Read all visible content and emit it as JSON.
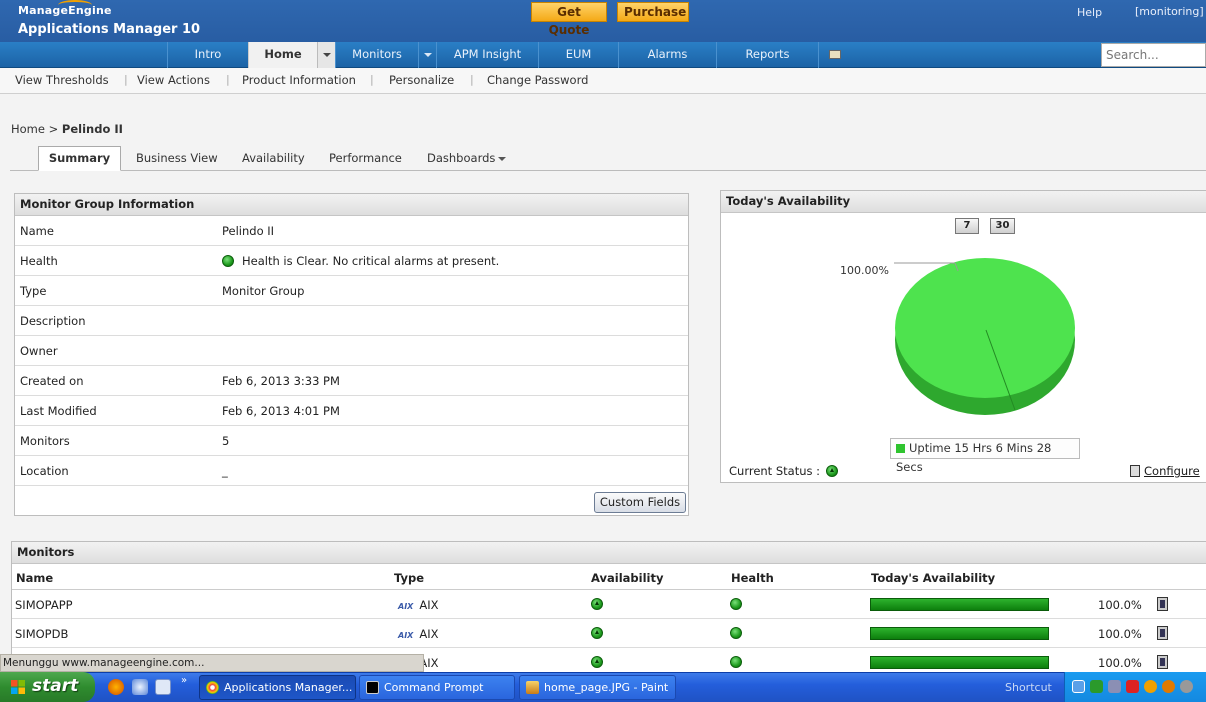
{
  "header": {
    "brand_top": "ManageEngine",
    "brand_bottom": "Applications Manager 10",
    "get_quote": "Get Quote",
    "purchase": "Purchase",
    "help": "Help",
    "user": "[monitoring]"
  },
  "nav": {
    "items": [
      "Intro",
      "Home",
      "Monitors",
      "APM Insight",
      "EUM",
      "Alarms",
      "Reports"
    ],
    "active": "Home",
    "search_placeholder": "Search..."
  },
  "subnav": [
    "View Thresholds",
    "View Actions",
    "Product Information",
    "Personalize",
    "Change Password"
  ],
  "breadcrumb": {
    "root": "Home >",
    "current": "Pelindo II"
  },
  "tabs": [
    "Summary",
    "Business View",
    "Availability",
    "Performance",
    "Dashboards"
  ],
  "group_info": {
    "title": "Monitor Group Information",
    "rows": [
      {
        "k": "Name",
        "v": "Pelindo II"
      },
      {
        "k": "Health",
        "v": "Health is Clear. No critical alarms at present."
      },
      {
        "k": "Type",
        "v": "Monitor Group"
      },
      {
        "k": "Description",
        "v": ""
      },
      {
        "k": "Owner",
        "v": ""
      },
      {
        "k": "Created on",
        "v": "Feb 6, 2013 3:33 PM"
      },
      {
        "k": "Last Modified",
        "v": "Feb 6, 2013 4:01 PM"
      },
      {
        "k": "Monitors",
        "v": "5"
      },
      {
        "k": "Location",
        "v": "_"
      }
    ],
    "custom_fields": "Custom Fields"
  },
  "availability": {
    "title": "Today's Availability",
    "period_7": "7",
    "period_30": "30",
    "pie_label": "100.00%",
    "legend": "Uptime 15 Hrs 6 Mins 28 Secs",
    "current_status": "Current Status :",
    "configure": "Configure",
    "uptime_fraction": 1.0,
    "pie_color": "#3fdc3f"
  },
  "monitors": {
    "title": "Monitors",
    "columns": [
      "Name",
      "Type",
      "Availability",
      "Health",
      "Today's Availability"
    ],
    "rows": [
      {
        "name": "SIMOPAPP",
        "type": "AIX",
        "today": "100.0%"
      },
      {
        "name": "SIMOPDB",
        "type": "AIX",
        "today": "100.0%"
      },
      {
        "name": "",
        "type": "AIX",
        "today": "100.0%"
      }
    ]
  },
  "status_bar": "Menunggu www.manageengine.com...",
  "taskbar": {
    "start": "start",
    "tasks": [
      "Applications Manager...",
      "Command Prompt",
      "home_page.JPG - Paint"
    ],
    "shortcut": "Shortcut"
  }
}
